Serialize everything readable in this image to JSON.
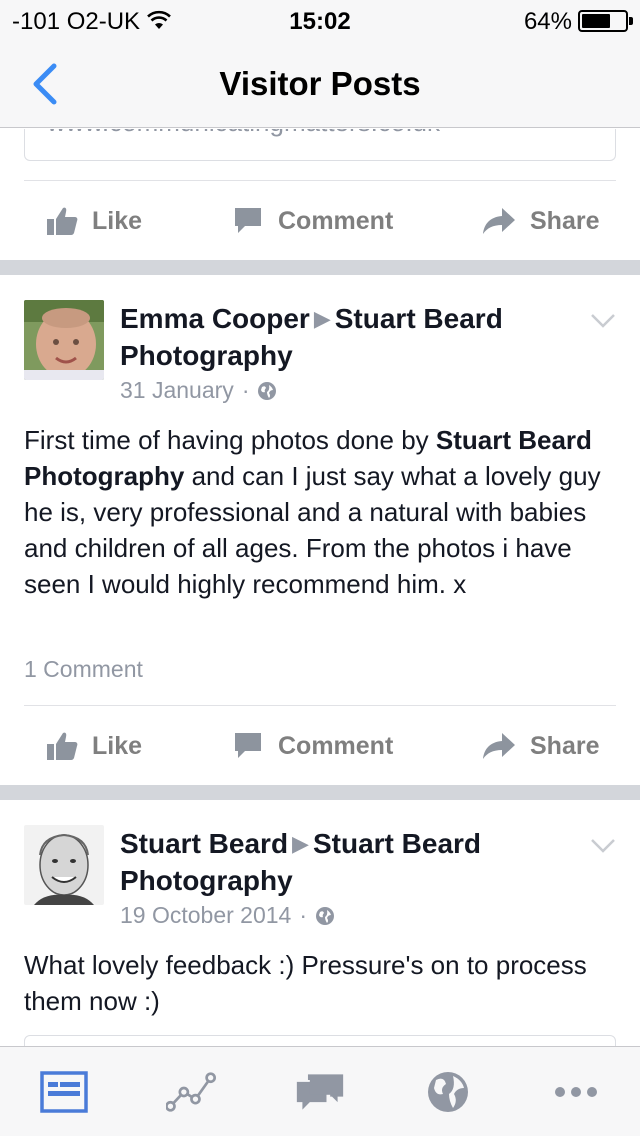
{
  "status_bar": {
    "carrier": "-101 O2-UK",
    "time": "15:02",
    "battery": "64%"
  },
  "nav": {
    "title": "Visitor Posts"
  },
  "link_preview": {
    "url": "www.communicatingmatters.co.uk"
  },
  "actions": {
    "like": "Like",
    "comment": "Comment",
    "share": "Share"
  },
  "posts": [
    {
      "author": "Emma Cooper",
      "target": "Stuart Beard Photography",
      "date": "31 January",
      "body_start": "First time of having photos done by ",
      "body_mention": "Stuart Beard Photography",
      "body_end": " and can I just say what a lovely guy he is, very professional and a natural with babies and children of all ages. From the photos i have seen I would highly recommend him. x",
      "comment_count": "1 Comment"
    },
    {
      "author": "Stuart Beard",
      "target": "Stuart Beard Photography",
      "date": "19 October 2014",
      "body": "What lovely feedback :) Pressure's on to process them now :)"
    }
  ],
  "tabs": [
    {
      "icon": "news-feed-icon",
      "active": true
    },
    {
      "icon": "insights-icon",
      "active": false
    },
    {
      "icon": "messages-icon",
      "active": false
    },
    {
      "icon": "globe-icon",
      "active": false
    },
    {
      "icon": "more-icon",
      "active": false
    }
  ],
  "colors": {
    "active_tab": "#4a7bd8",
    "inactive": "#9197a3",
    "back": "#3b8cf5"
  }
}
